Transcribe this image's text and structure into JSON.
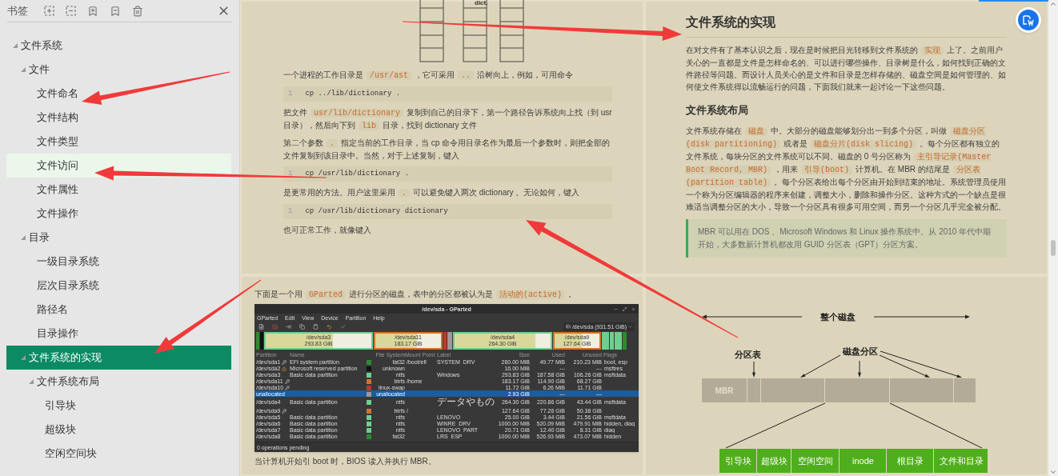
{
  "sidebar": {
    "title": "书签",
    "tree": [
      {
        "label": "文件系统",
        "expanded": true,
        "selected": false,
        "hovered": false,
        "children": [
          {
            "label": "文件",
            "expanded": true,
            "selected": false,
            "hovered": false,
            "children": [
              {
                "label": "文件命名",
                "selected": false,
                "hovered": false
              },
              {
                "label": "文件结构",
                "selected": false,
                "hovered": false
              },
              {
                "label": "文件类型",
                "selected": false,
                "hovered": false
              },
              {
                "label": "文件访问",
                "selected": false,
                "hovered": true
              },
              {
                "label": "文件属性",
                "selected": false,
                "hovered": false
              },
              {
                "label": "文件操作",
                "selected": false,
                "hovered": false
              }
            ]
          },
          {
            "label": "目录",
            "expanded": true,
            "selected": false,
            "hovered": false,
            "children": [
              {
                "label": "一级目录系统",
                "selected": false,
                "hovered": false
              },
              {
                "label": "层次目录系统",
                "selected": false,
                "hovered": false
              },
              {
                "label": "路径名",
                "selected": false,
                "hovered": false
              },
              {
                "label": "目录操作",
                "selected": false,
                "hovered": false
              }
            ]
          },
          {
            "label": "文件系统的实现",
            "expanded": true,
            "selected": true,
            "hovered": false,
            "children": [
              {
                "label": "文件系统布局",
                "expanded": true,
                "selected": false,
                "hovered": false,
                "children": [
                  {
                    "label": "引导块",
                    "selected": false,
                    "hovered": false
                  },
                  {
                    "label": "超级块",
                    "selected": false,
                    "hovered": false
                  },
                  {
                    "label": "空闲空间块",
                    "selected": false,
                    "hovered": false
                  }
                ]
              }
            ]
          }
        ]
      }
    ]
  },
  "pages": {
    "top_left": {
      "diagram_label": "dict.",
      "blocks": [
        {
          "kind": "p",
          "segments": [
            {
              "kind": "text",
              "text": "一个进程的工作目录是"
            },
            {
              "kind": "code",
              "text": "/usr/ast"
            },
            {
              "kind": "text",
              "text": "，它可采用"
            },
            {
              "kind": "code",
              "text": ".."
            },
            {
              "kind": "text",
              "text": "沿树向上，例如，可用命令"
            }
          ]
        },
        {
          "kind": "code",
          "line": "1",
          "code": "cp ../lib/dictionary ."
        },
        {
          "kind": "p",
          "segments": [
            {
              "kind": "text",
              "text": "把文件"
            },
            {
              "kind": "code",
              "text": "usr/lib/dictionary"
            },
            {
              "kind": "text",
              "text": "复制到自己的目录下，第一个路径告诉系统向上找（到 usr 目录），然后向下到"
            },
            {
              "kind": "code",
              "text": "lib"
            },
            {
              "kind": "text",
              "text": "目录，找到 dictionary 文件"
            }
          ]
        },
        {
          "kind": "p",
          "segments": [
            {
              "kind": "text",
              "text": "第二个参数"
            },
            {
              "kind": "code",
              "text": "."
            },
            {
              "kind": "text",
              "text": "指定当前的工作目录，当 cp 命令用目录名作为最后一个参数时，则把全部的文件复制到该目录中。当然，对于上述复制，键入"
            }
          ]
        },
        {
          "kind": "code",
          "line": "1",
          "code": "cp /usr/lib/dictionary ."
        },
        {
          "kind": "p",
          "segments": [
            {
              "kind": "text",
              "text": "是更常用的方法。用户这里采用"
            },
            {
              "kind": "code",
              "text": "."
            },
            {
              "kind": "text",
              "text": "可以避免键入两次 dictionary 。无论如何，键入"
            }
          ]
        },
        {
          "kind": "code",
          "line": "1",
          "code": "cp /usr/lib/dictionary dictionary"
        },
        {
          "kind": "p",
          "segments": [
            {
              "kind": "text",
              "text": "也可正常工作，就像键入"
            }
          ]
        }
      ]
    },
    "top_right": {
      "blocks": [
        {
          "kind": "h2",
          "segments": [
            {
              "kind": "text",
              "text": "文件系统的实现"
            }
          ]
        },
        {
          "kind": "p",
          "segments": [
            {
              "kind": "text",
              "text": "在对文件有了基本认识之后，现在是时候把目光转移到文件系统的"
            },
            {
              "kind": "code",
              "text": "实现"
            },
            {
              "kind": "text",
              "text": "上了。之前用户关心的一直都是文件是怎样命名的、可以进行哪些操作、目录树是什么，如何找到正确的文件路径等问题。而设计人员关心的是文件和目录是怎样存储的、磁盘空间是如何管理的、如何使文件系统得以流畅运行的问题，下面我们就来一起讨论一下这些问题。"
            }
          ]
        },
        {
          "kind": "h3",
          "segments": [
            {
              "kind": "text",
              "text": "文件系统布局"
            }
          ]
        },
        {
          "kind": "p",
          "segments": [
            {
              "kind": "text",
              "text": "文件系统存储在"
            },
            {
              "kind": "code",
              "text": "磁盘"
            },
            {
              "kind": "text",
              "text": "中。大部分的磁盘能够划分出一到多个分区，叫做"
            },
            {
              "kind": "code",
              "text": "磁盘分区(disk partitioning)"
            },
            {
              "kind": "text",
              "text": "或者是"
            },
            {
              "kind": "code",
              "text": "磁盘分片(disk slicing)"
            },
            {
              "kind": "text",
              "text": "。每个分区都有独立的文件系统，每块分区的文件系统可以不同。磁盘的 0 号分区称为"
            },
            {
              "kind": "code",
              "text": "主引导记录(Master Boot Record, MBR)"
            },
            {
              "kind": "text",
              "text": "，用来"
            },
            {
              "kind": "code",
              "text": "引导(boot)"
            },
            {
              "kind": "text",
              "text": "计算机。在 MBR 的结尾是"
            },
            {
              "kind": "code",
              "text": "分区表(partition table)"
            },
            {
              "kind": "text",
              "text": "。每个分区表给出每个分区由开始到结束的地址。系统管理员使用一个称为分区编辑器的程序来创建，调整大小，删除和操作分区。这种方式的一个缺点是很难适当调整分区的大小，导致一个分区具有很多可用空间，而另一个分区几乎完全被分配。"
            }
          ]
        },
        {
          "kind": "quote",
          "segments": [
            {
              "kind": "text",
              "text": "MBR 可以用在 DOS 、Microsoft Windows 和 Linux 操作系统中。从 2010 年代中期开始，大多数新计算机都改用 GUID 分区表（GPT）分区方案。"
            }
          ]
        }
      ]
    },
    "bottom_left": {
      "intro": [
        {
          "kind": "text",
          "text": "下面是一个用"
        },
        {
          "kind": "code",
          "text": "GParted"
        },
        {
          "kind": "text",
          "text": "进行分区的磁盘，表中的分区都被认为是"
        },
        {
          "kind": "code",
          "text": "活动的(active)"
        },
        {
          "kind": "text",
          "text": "。"
        }
      ],
      "gparted": {
        "title": "/dev/sda - GParted",
        "menus": [
          "GParted",
          "Edit",
          "View",
          "Device",
          "Partition",
          "Help"
        ],
        "device": "/dev/sda (931.51 GiB)",
        "segments": [
          {
            "color": "#2e8b2e"
          },
          {
            "color": "#111111"
          },
          {
            "name": "/dev/sda3",
            "size": "293.83 GiB",
            "color": "#6ecf8f",
            "level": 0.64
          },
          {
            "name": "/dev/sda11",
            "size": "183.17 GiB",
            "color": "#d2742c",
            "level": 0.63
          },
          {
            "color": "#c0392b"
          },
          {
            "color": "#9a9a9a"
          },
          {
            "name": "/dev/sda4",
            "size": "264.30 GiB",
            "color": "#6ecf8f",
            "level": 0.84
          },
          {
            "name": "/dev/sda9",
            "size": "127.64 GiB",
            "color": "#d2742c",
            "level": 0.6
          },
          {
            "color": "#6ecf8f"
          },
          {
            "color": "#6ecf8f"
          },
          {
            "color": "#6ecf8f"
          },
          {
            "color": "#2e8b2e"
          }
        ],
        "columns": [
          "Partition",
          "Name",
          "File System",
          "Mount Point",
          "Label",
          "Size",
          "Used",
          "Unused",
          "Flags"
        ],
        "rows": [
          {
            "partition": "/dev/sda1",
            "kind": "busy",
            "name": "EFI system partition",
            "color": "#2e8b2e",
            "fs": "fat32",
            "mount": "/boot/efi",
            "label": "SYSTEM_DRV",
            "size": "260.00 MiB",
            "used": "49.77 MiB",
            "unused": "210.23 MiB",
            "flags": "boot, esp",
            "selected": false
          },
          {
            "partition": "/dev/sda2",
            "kind": "warning",
            "name": "Microsoft reserved partition",
            "color": "#111111",
            "fs": "unknown",
            "mount": "",
            "label": "",
            "size": "16.00 MiB",
            "used": "---",
            "unused": "---",
            "flags": "msftres",
            "selected": false
          },
          {
            "partition": "/dev/sda3",
            "kind": "plain",
            "name": "Basic data partition",
            "color": "#6ecf8f",
            "fs": "ntfs",
            "mount": "",
            "label": "Windows",
            "size": "293.83 GiB",
            "used": "187.58 GiB",
            "unused": "106.26 GiB",
            "flags": "msftdata",
            "selected": false
          },
          {
            "partition": "/dev/sda11",
            "kind": "busy",
            "name": "",
            "color": "#d2742c",
            "fs": "btrfs",
            "mount": "/home",
            "label": "",
            "size": "183.17 GiB",
            "used": "114.90 GiB",
            "unused": "68.27 GiB",
            "flags": "",
            "selected": false
          },
          {
            "partition": "/dev/sda10",
            "kind": "busy",
            "name": "",
            "color": "#c0392b",
            "fs": "linux-swap",
            "mount": "",
            "label": "",
            "size": "11.72 GiB",
            "used": "6.26 MiB",
            "unused": "11.71 GiB",
            "flags": "",
            "selected": false
          },
          {
            "partition": "unallocated",
            "kind": "plain",
            "name": "",
            "color": "#9a9a9a",
            "fs": "unallocated",
            "mount": "",
            "label": "",
            "size": "2.93 GiB",
            "used": "---",
            "unused": "---",
            "flags": "",
            "selected": true
          },
          {
            "partition": "/dev/sda4",
            "kind": "plain",
            "name": "Basic data partition",
            "color": "#6ecf8f",
            "fs": "ntfs",
            "mount": "",
            "label": "データやもの",
            "size": "264.30 GiB",
            "used": "220.86 GiB",
            "unused": "43.44 GiB",
            "flags": "msftdata",
            "selected": false
          },
          {
            "partition": "/dev/sda9",
            "kind": "busy",
            "name": "",
            "color": "#d2742c",
            "fs": "btrfs",
            "mount": "/",
            "label": "",
            "size": "127.64 GiB",
            "used": "77.26 GiB",
            "unused": "50.38 GiB",
            "flags": "",
            "selected": false
          },
          {
            "partition": "/dev/sda5",
            "kind": "plain",
            "name": "Basic data partition",
            "color": "#6ecf8f",
            "fs": "ntfs",
            "mount": "",
            "label": "LENOVO",
            "size": "25.00 GiB",
            "used": "3.44 GiB",
            "unused": "21.56 GiB",
            "flags": "msftdata",
            "selected": false
          },
          {
            "partition": "/dev/sda6",
            "kind": "plain",
            "name": "Basic data partition",
            "color": "#6ecf8f",
            "fs": "ntfs",
            "mount": "",
            "label": "WINRE_DRV",
            "size": "1000.00 MiB",
            "used": "520.09 MiB",
            "unused": "479.91 MiB",
            "flags": "hidden, diag",
            "selected": false
          },
          {
            "partition": "/dev/sda7",
            "kind": "plain",
            "name": "Basic data partition",
            "color": "#6ecf8f",
            "fs": "ntfs",
            "mount": "",
            "label": "LENOVO_PART",
            "size": "20.71 GiB",
            "used": "12.40 GiB",
            "unused": "8.31 GiB",
            "flags": "diag",
            "selected": false
          },
          {
            "partition": "/dev/sda8",
            "kind": "plain",
            "name": "Basic data partition",
            "color": "#2e8b2e",
            "fs": "fat32",
            "mount": "",
            "label": "LRS_ESP",
            "size": "1000.00 MiB",
            "used": "526.93 MiB",
            "unused": "473.07 MiB",
            "flags": "hidden",
            "selected": false
          }
        ],
        "status": "0 operations pending"
      },
      "outro": [
        {
          "kind": "text",
          "text": "当计算机开始引 boot 时，BIOS 读入并执行 MBR。"
        }
      ]
    },
    "bottom_right": {
      "whole_disk": "整个磁盘",
      "partition_table": "分区表",
      "disk_partitions": "磁盘分区",
      "mbr": "MBR",
      "layout_blocks": [
        "引导块",
        "超级块",
        "空闲空间",
        "inode",
        "根目录",
        "文件和目录"
      ]
    }
  }
}
